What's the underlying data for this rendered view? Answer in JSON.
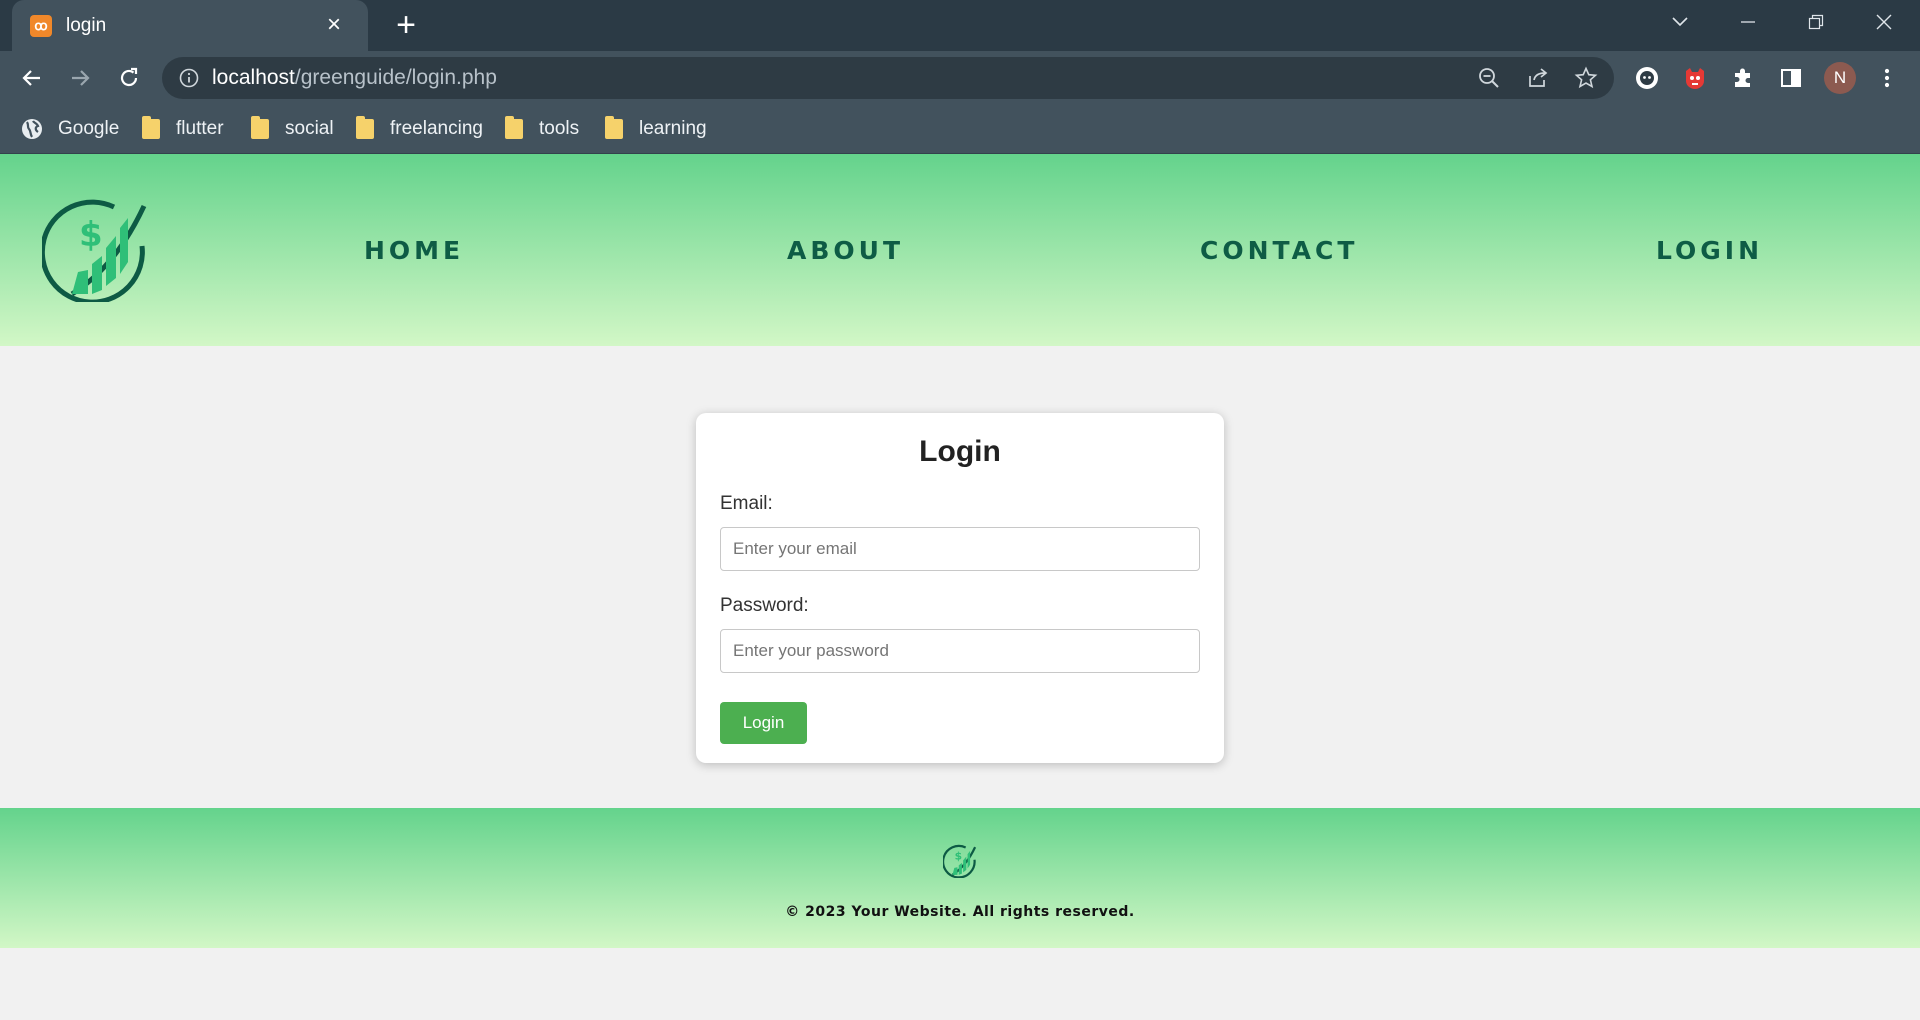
{
  "browser": {
    "tab_title": "login",
    "url_host": "localhost",
    "url_path": "/greenguide/login.php",
    "profile_initial": "N",
    "bookmarks": [
      {
        "label": "Google",
        "icon": "globe-icon"
      },
      {
        "label": "flutter",
        "icon": "folder-icon"
      },
      {
        "label": "social",
        "icon": "folder-icon"
      },
      {
        "label": "freelancing",
        "icon": "folder-icon"
      },
      {
        "label": "tools",
        "icon": "folder-icon"
      },
      {
        "label": "learning",
        "icon": "folder-icon"
      }
    ]
  },
  "nav": {
    "items": [
      {
        "label": "HOME"
      },
      {
        "label": "ABOUT"
      },
      {
        "label": "CONTACT"
      },
      {
        "label": "LOGIN"
      }
    ],
    "logo_symbol": "$"
  },
  "login_form": {
    "title": "Login",
    "email_label": "Email:",
    "email_placeholder": "Enter your email",
    "password_label": "Password:",
    "password_placeholder": "Enter your password",
    "submit_label": "Login"
  },
  "footer": {
    "copyright": "© 2023 Your Website. All rights reserved."
  },
  "colors": {
    "header_gradient_top": "#64d38c",
    "header_gradient_bottom": "#d2f7c6",
    "nav_text": "#0e5c45",
    "button": "#4caf50"
  }
}
